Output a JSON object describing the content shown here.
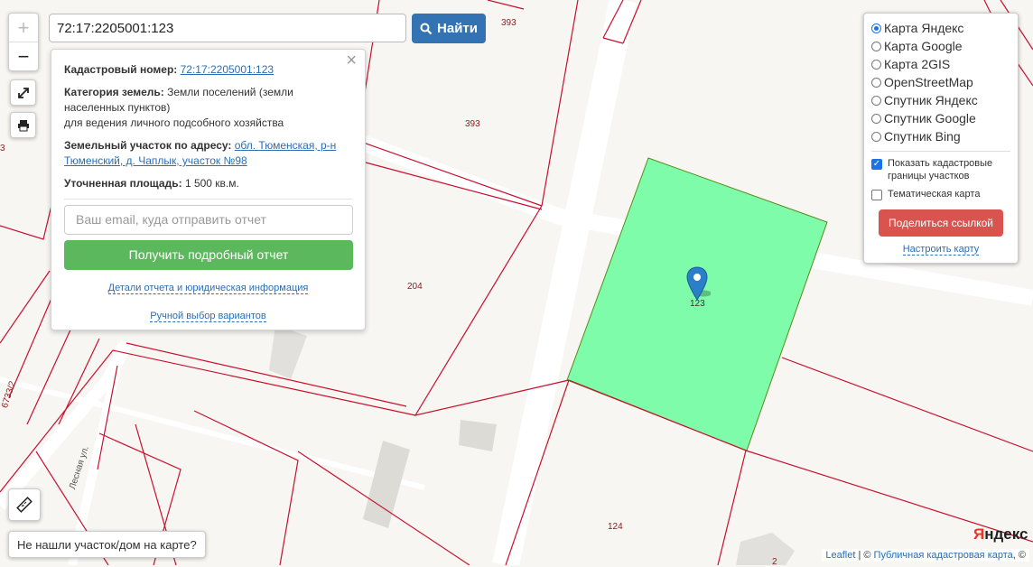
{
  "map": {
    "parcel_labels": [
      {
        "id": "l393a",
        "text": "393"
      },
      {
        "id": "l393b",
        "text": "393"
      },
      {
        "id": "l204",
        "text": "204"
      },
      {
        "id": "l124",
        "text": "124"
      },
      {
        "id": "l123",
        "text": "123"
      },
      {
        "id": "l3",
        "text": "3"
      },
      {
        "id": "l6733",
        "text": "6733/2"
      },
      {
        "id": "l2",
        "text": "2"
      }
    ],
    "street_label": "Лесная ул.",
    "selected_parcel_color": "#7ffcaa",
    "boundary_color": "#c8102e"
  },
  "zoom": {
    "in_label": "+",
    "out_label": "−"
  },
  "search": {
    "value": "72:17:2205001:123",
    "button_label": "Найти"
  },
  "popup": {
    "close_label": "×",
    "cadastral_label": "Кадастровый номер:",
    "cadastral_value": "72:17:2205001:123",
    "category_label": "Категория земель:",
    "category_value": "Земли поселений (земли населенных пунктов)",
    "category_use": "для ведения личного подсобного хозяйства",
    "address_label": "Земельный участок по адресу:",
    "address_value": "обл. Тюменская, р-н Тюменский, д. Чаплык, участок №98",
    "area_label": "Уточненная площадь:",
    "area_value": "1 500 кв.м.",
    "email_placeholder": "Ваш email, куда отправить отчет",
    "report_button": "Получить подробный отчет",
    "details_link": "Детали отчета и юридическая информация",
    "manual_link": "Ручной выбор вариантов"
  },
  "layers": {
    "items": [
      {
        "label": "Карта Яндекс",
        "selected": true
      },
      {
        "label": "Карта Google",
        "selected": false
      },
      {
        "label": "Карта 2GIS",
        "selected": false
      },
      {
        "label": "OpenStreetMap",
        "selected": false
      },
      {
        "label": "Спутник Яндекс",
        "selected": false
      },
      {
        "label": "Спутник Google",
        "selected": false
      },
      {
        "label": "Спутник Bing",
        "selected": false
      }
    ],
    "show_boundaries_label": "Показать кадастровые границы участков",
    "show_boundaries_checked": true,
    "thematic_label": "Тематическая карта",
    "thematic_checked": false,
    "share_button": "Поделиться ссылкой",
    "configure_link": "Настроить карту"
  },
  "not_found_button": "Не нашли участок/дом на карте?",
  "attribution": {
    "leaflet": "Leaflet",
    "sep": " | © ",
    "cadastral": "Публичная кадастровая карта",
    "tail": ", ©"
  },
  "yandex_logo": {
    "first": "Я",
    "rest": "ндекс"
  }
}
